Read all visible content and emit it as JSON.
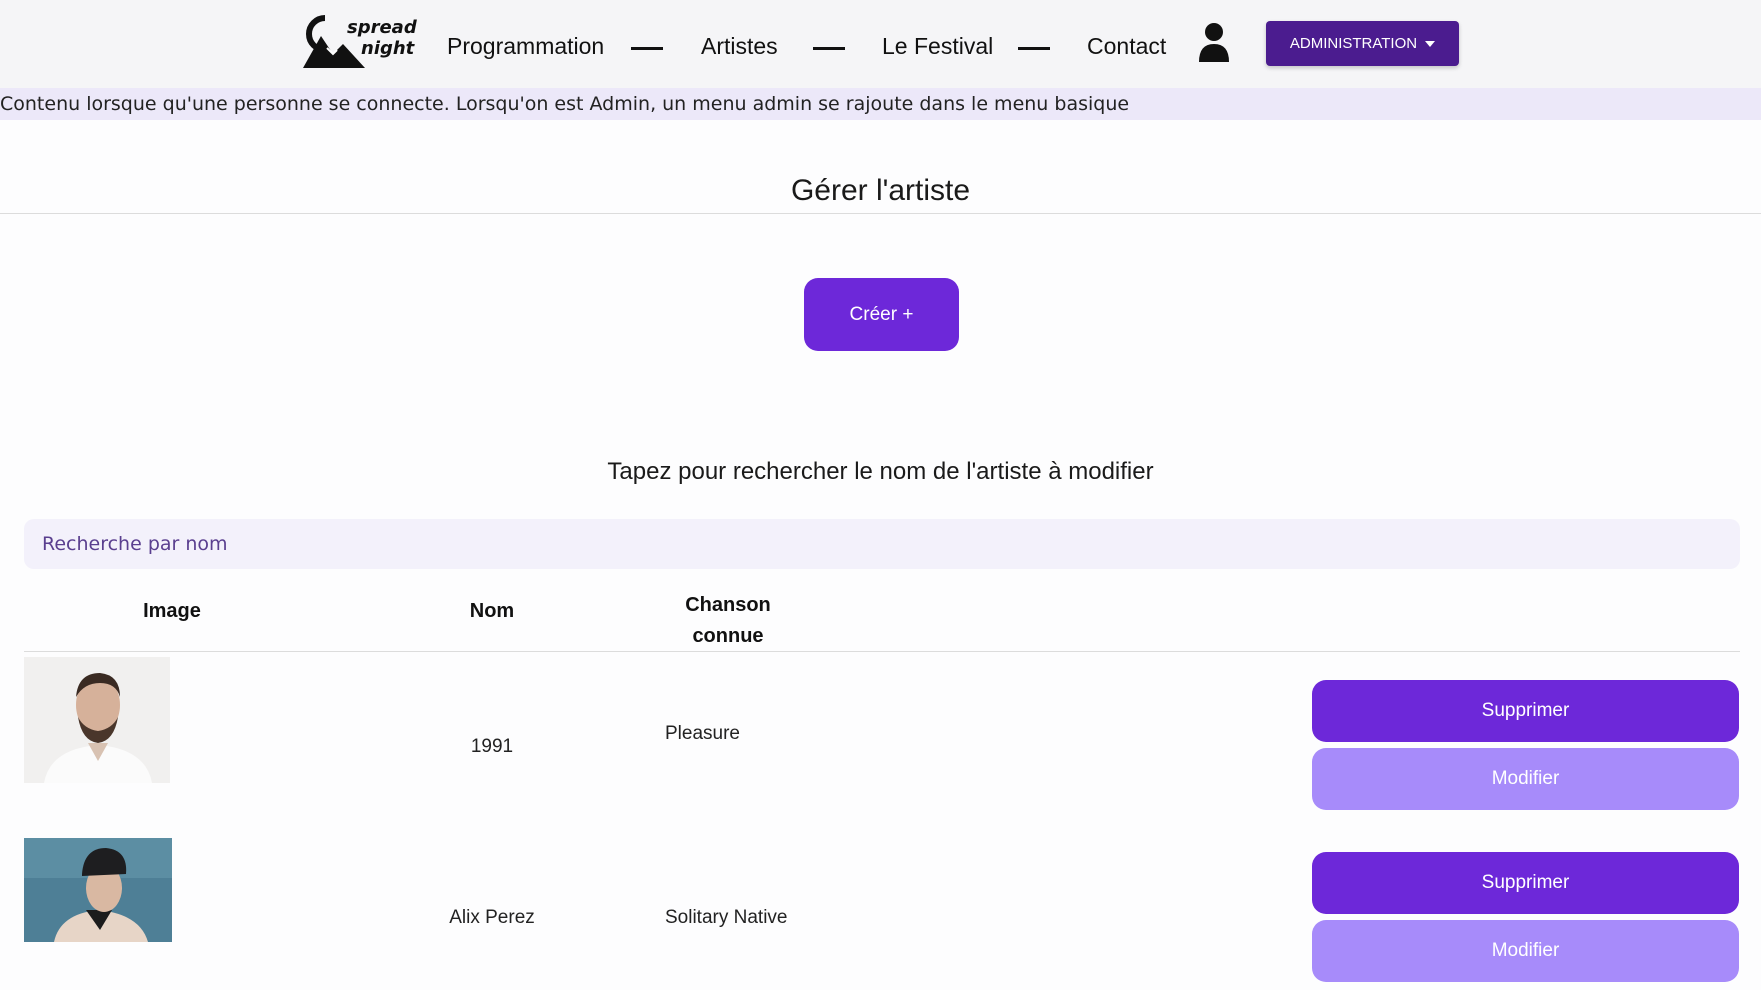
{
  "header": {
    "logo_text": "SPREAD NIGHT",
    "nav": [
      "Programmation",
      "Artistes",
      "Le Festival",
      "Contact"
    ],
    "admin_label": "Administration"
  },
  "notice": "Contenu lorsque qu'une personne se connecte. Lorsqu'on est Admin, un menu admin se rajoute dans le menu basique",
  "main": {
    "title": "Gérer l'artiste",
    "create_label": "Créer +",
    "search_label": "Tapez pour rechercher le nom de l'artiste à modifier",
    "search_placeholder": "Recherche par nom"
  },
  "table": {
    "headers": [
      "Image",
      "Nom",
      "Chanson connue"
    ],
    "rows": [
      {
        "nom": "1991",
        "chanson": "Pleasure",
        "delete_label": "Supprimer",
        "edit_label": "Modifier"
      },
      {
        "nom": "Alix Perez",
        "chanson": "Solitary Native",
        "delete_label": "Supprimer",
        "edit_label": "Modifier"
      }
    ]
  },
  "colors": {
    "primary": "#6d28d9",
    "secondary": "#a78bfa",
    "admin": "#4b1c8f",
    "notice_bg": "#ece8f9"
  }
}
